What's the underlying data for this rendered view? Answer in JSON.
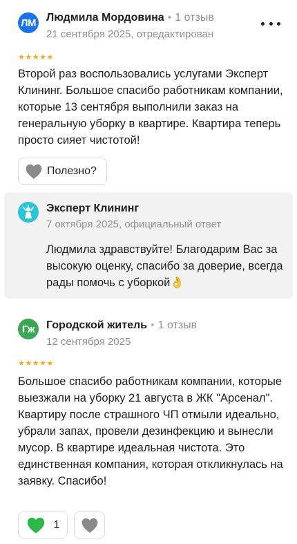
{
  "reviews": [
    {
      "avatar_initials": "ЛМ",
      "avatar_color": "#1a73e8",
      "author": "Людмила Мордовина",
      "reviews_count": "1 отзыв",
      "date": "21 сентября 2025, отредактирован",
      "rating": 5,
      "stars": "★★★★★",
      "text": "Второй раз воспользовались услугами Эксперт Клининг. Большое спасибо работникам компании, которые 13 сентября выполнили заказ на генеральную уборку в квартире. Квартира теперь просто сияет чистотой!",
      "helpful_label": "Полезно?"
    },
    {
      "avatar_initials": "Гж",
      "avatar_color": "#3aa755",
      "author": "Городской житель",
      "reviews_count": "1 отзыв",
      "date": "12 сентября 2025",
      "rating": 5,
      "stars": "★★★★★",
      "text": "Большое спасибо работникам компании, которые выезжали на уборку 21 августа в ЖК \"Арсенал\". Квартиру после страшного ЧП отмыли идеально, убрали запах, провели дезинфекцию и вынесли мусор. В квартире идеальная чистота. Это единственная компания, которая откликнулась на заявку. Спасибо!",
      "likes_count": "1"
    }
  ],
  "reply": {
    "company": "Эксперт Клининг",
    "date": "7 октября 2025, официальный ответ",
    "text": "Людмила здравствуйте! Благодарим Вас за высокую оценку, спасибо за доверие, всегда рады помочь с уборкой👌"
  },
  "colors": {
    "star": "#f6a623",
    "like_active": "#2db84a",
    "like_inactive": "#8a8a8a",
    "reply_bg": "#f2f2f2"
  },
  "icons": {
    "more": "more-dots-icon",
    "heart": "heart-icon",
    "company_logo": "company-logo-icon"
  }
}
